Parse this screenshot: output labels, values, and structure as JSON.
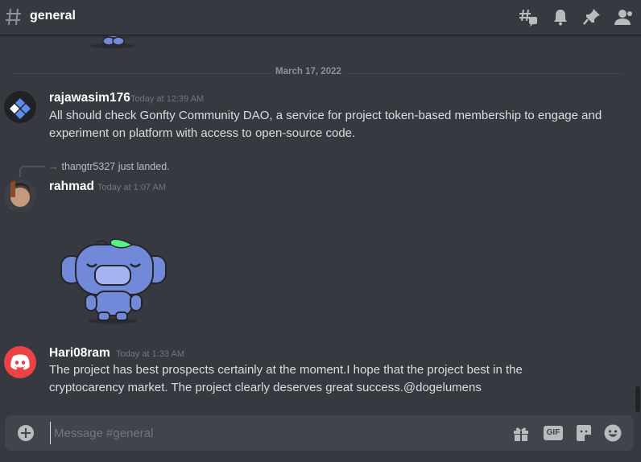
{
  "header": {
    "channel_name": "general",
    "icons": [
      "threads-icon",
      "bell-icon",
      "pin-icon",
      "members-icon"
    ]
  },
  "divider": {
    "date": "March 17, 2022"
  },
  "messages": [
    {
      "username": "rajawasim176",
      "timestamp": "Today at 12:39 AM",
      "text": "All should check Gonfty Community DAO, a service for project token-based membership to engage and experiment on platform with access to open-source code."
    },
    {
      "system": "thangtr5327 just landed.",
      "username": "rahmad",
      "timestamp": "Today at 1:07 AM",
      "sticker": "wumpus-sticker"
    },
    {
      "username": "Hari08ram",
      "timestamp": "Today at 1:33 AM",
      "text": "The project has best prospects certainly at the moment.I hope that the project best in the cryptocarency market. The project clearly deserves great success.@dogelumens"
    }
  ],
  "composer": {
    "placeholder": "Message #general",
    "value": "",
    "gif_label": "GIF"
  },
  "colors": {
    "background": "#36393f",
    "composer": "#40444b",
    "discord_red": "#ed4245",
    "sticker_blue": "#7289da"
  }
}
